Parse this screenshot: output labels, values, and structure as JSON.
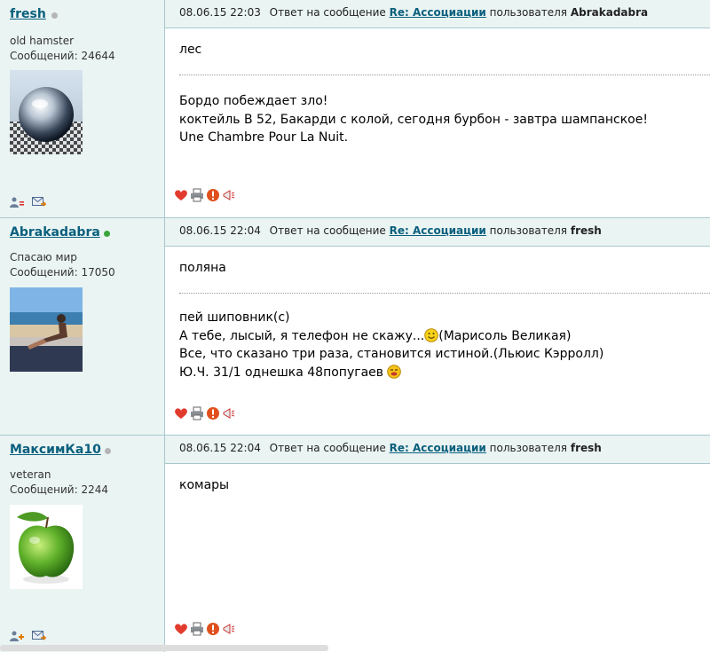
{
  "posts": [
    {
      "username": "fresh",
      "online": false,
      "rank": "old hamster",
      "messages_label": "Сообщений: 24644",
      "timestamp": "08.06.15 22:03",
      "reply_prefix": "Ответ на сообщение",
      "reply_link": "Re: Ассоциации",
      "reply_suffix": "пользователя",
      "reply_user": "Abrakadabra",
      "subject": "лес",
      "signature": [
        "Бордо побеждает зло!",
        "коктейль В 52, Бакарди с колой, сегодня бурбон - завтра шампанское!",
        "Une Chambre Pour La Nuit."
      ],
      "avatar_icon": "chrome-sphere-avatar"
    },
    {
      "username": "Abrakadabra",
      "online": true,
      "rank": "Спасаю мир",
      "messages_label": "Сообщений: 17050",
      "timestamp": "08.06.15 22:04",
      "reply_prefix": "Ответ на сообщение",
      "reply_link": "Re: Ассоциации",
      "reply_suffix": "пользователя",
      "reply_user": "fresh",
      "subject": "поляна",
      "signature": [
        "пей шиповник(с)",
        "А тебе, лысый, я телефон не скажу...",
        "(Марисоль Великая)",
        "Все, что сказано три раза, становится истиной.(Льюис Кэрролл)",
        "Ю.Ч. 31/1 однешка 48попугаев"
      ],
      "avatar_icon": "beach-avatar"
    },
    {
      "username": "МаксимКа10",
      "online": false,
      "rank": "veteran",
      "messages_label": "Сообщений: 2244",
      "timestamp": "08.06.15 22:04",
      "reply_prefix": "Ответ на сообщение",
      "reply_link": "Re: Ассоциации",
      "reply_suffix": "пользователя",
      "reply_user": "fresh",
      "subject": "комары",
      "signature": [],
      "avatar_icon": "green-apple-avatar"
    }
  ],
  "icons": {
    "status_online": "#3aa53a",
    "status_offline": "#b5b5b5"
  },
  "colors": {
    "panel_bg": "#eaf4f3",
    "border": "#a8c8cc",
    "link": "#0a5f7d"
  }
}
